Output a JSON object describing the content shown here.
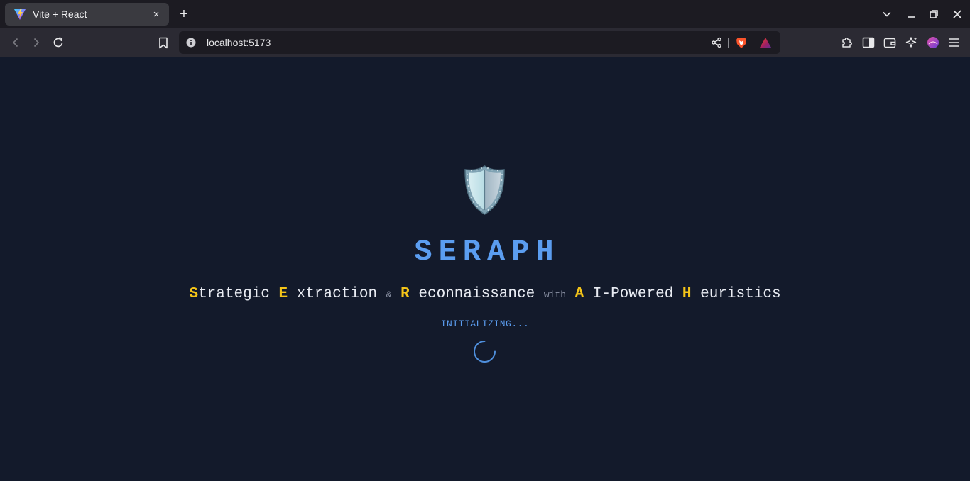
{
  "browser": {
    "tab": {
      "title": "Vite + React",
      "close_glyph": "×"
    },
    "new_tab_glyph": "+",
    "url": "localhost:5173",
    "icons": {
      "favicon": "vite-icon",
      "back": "back-arrow-icon",
      "forward": "forward-arrow-icon",
      "reload": "reload-icon",
      "bookmark": "bookmark-icon",
      "site_info": "info-icon",
      "share": "share-icon",
      "brave_shields": "brave-lion-icon",
      "rewards": "brave-rewards-icon",
      "extensions": "puzzle-icon",
      "sidebar": "sidebar-icon",
      "wallet": "wallet-icon",
      "leo": "sparkle-icon",
      "profile": "profile-avatar-icon",
      "menu": "hamburger-menu-icon"
    },
    "colors": {
      "tabbar": "#1c1b22",
      "toolbar": "#2b2a33",
      "active_tab": "#3a3a40"
    }
  },
  "page": {
    "title": "SERAPH",
    "tagline": {
      "s_initial": "S",
      "s_rest": "trategic",
      "e_initial": "E",
      "e_rest": "xtraction",
      "amp": "&",
      "r_initial": "R",
      "r_rest": "econnaissance",
      "with": "with",
      "a_initial": "A",
      "a_rest": "I-Powered",
      "h_initial": "H",
      "h_rest": "euristics"
    },
    "status": "INITIALIZING...",
    "colors": {
      "background": "#131a2b",
      "accent": "#5b9df0",
      "highlight": "#f5c518"
    },
    "icons": {
      "logo": "shield-icon",
      "loader": "spinner-icon"
    }
  }
}
